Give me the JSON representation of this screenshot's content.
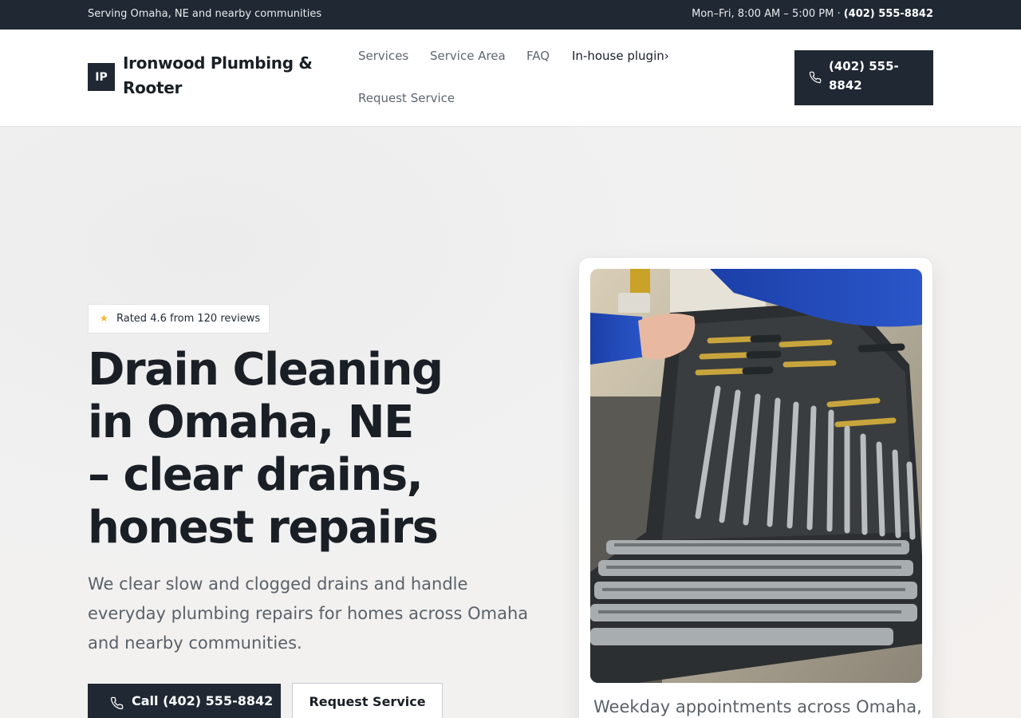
{
  "topbar": {
    "left_text": "Serving Omaha, NE and nearby communities",
    "hours": "Mon–Fri, 8:00 AM – 5:00 PM ·",
    "phone": "(402) 555-8842"
  },
  "header": {
    "logo_initials": "IP",
    "brand_name": "Ironwood Plumbing & Rooter",
    "nav": [
      "Services",
      "Service Area",
      "FAQ",
      "In-house plugin›",
      "Request Service"
    ],
    "call_button": "(402) 555-8842",
    "call_icon": "phone-icon"
  },
  "hero": {
    "rating": "Rated 4.6 from 120 reviews",
    "rating_icon": "star-icon",
    "title_line1": "Drain Cleaning",
    "title_line2": "in Omaha, NE",
    "title_line3": "– clear drains,",
    "title_line4": "honest repairs",
    "lede": "We clear slow and clogged drains and handle everyday plumbing repairs for homes across Omaha and nearby communities.",
    "primary_button": "Call (402) 555-8842",
    "secondary_button": "Request Service",
    "card_caption": "Weekday appointments across Omaha,"
  },
  "colors": {
    "dark": "#1f2833",
    "star": "#f0b429",
    "muted_text": "#5b6168"
  }
}
